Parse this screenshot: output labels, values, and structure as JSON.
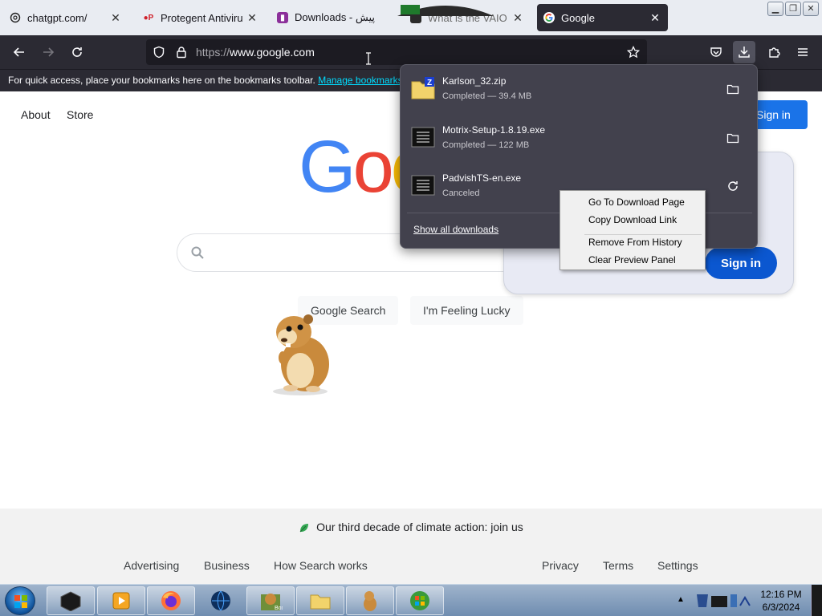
{
  "tabs": [
    {
      "title": "chatgpt.com/",
      "icon": "chatgpt-icon",
      "close": "✕"
    },
    {
      "title": "Protegent Antivirus F",
      "icon": "protegent-icon",
      "close": "✕"
    },
    {
      "title": "Downloads - چاپ پیش",
      "icon": "downloads-site-icon",
      "close": "✕"
    },
    {
      "title": "What is the VAIO Gal",
      "icon": "vaio-icon",
      "close": "✕"
    },
    {
      "title": "Google",
      "icon": "google-icon",
      "close": "✕"
    }
  ],
  "address": {
    "scheme": "https://",
    "host": "www.google.com"
  },
  "bookmarks_bar": {
    "text": "For quick access, place your bookmarks here on the bookmarks toolbar.",
    "link": "Manage bookmarks..."
  },
  "google": {
    "top_links": [
      "About",
      "Store"
    ],
    "signin_label": "Sign in",
    "logo_letters": [
      "G",
      "o",
      "o"
    ],
    "search_buttons": [
      "Google Search",
      "I'm Feeling Lucky"
    ],
    "card_signin_label": "Sign in",
    "climate_text": "Our third decade of climate action: join us",
    "footer_left": [
      "Advertising",
      "Business",
      "How Search works"
    ],
    "footer_right": [
      "Privacy",
      "Terms",
      "Settings"
    ]
  },
  "downloads": {
    "items": [
      {
        "name": "Karlson_32.zip",
        "status": "Completed — 39.4 MB",
        "action_icon": "folder-icon"
      },
      {
        "name": "Motrix-Setup-1.8.19.exe",
        "status": "Completed — 122 MB",
        "action_icon": "folder-icon"
      },
      {
        "name": "PadvishTS-en.exe",
        "status": "Canceled",
        "action_icon": "retry-icon"
      }
    ],
    "show_all": "Show all downloads"
  },
  "context_menu": {
    "items": [
      "Go To Download Page",
      "Copy Download Link",
      "Remove From History",
      "Clear Preview Panel"
    ]
  },
  "taskbar": {
    "time": "12:16 PM",
    "date": "6/3/2024"
  },
  "colors": {
    "google_blue": "#4285f4",
    "google_red": "#ea4335",
    "google_yellow": "#fbbc05",
    "firefox_dark": "#2b2a33",
    "panel_bg": "#42414d"
  }
}
